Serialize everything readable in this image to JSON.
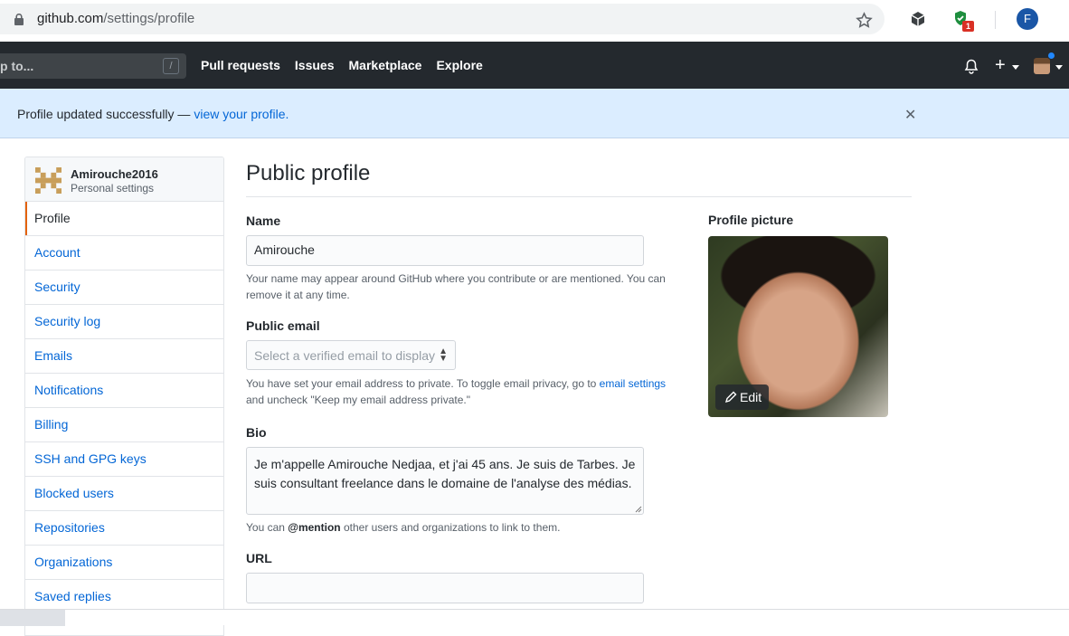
{
  "browser": {
    "url_host": "github.com",
    "url_path": "/settings/profile",
    "ext_badge": "1",
    "profile_initial": "F"
  },
  "header": {
    "search_placeholder": "p to...",
    "search_shortcut": "/",
    "nav": [
      "Pull requests",
      "Issues",
      "Marketplace",
      "Explore"
    ]
  },
  "flash": {
    "message": "Profile updated successfully — ",
    "link": "view your profile.",
    "close_icon": "close-icon"
  },
  "sidebar": {
    "username": "Amirouche2016",
    "subtitle": "Personal settings",
    "items": [
      "Profile",
      "Account",
      "Security",
      "Security log",
      "Emails",
      "Notifications",
      "Billing",
      "SSH and GPG keys",
      "Blocked users",
      "Repositories",
      "Organizations",
      "Saved replies"
    ],
    "active": "Profile"
  },
  "main": {
    "title": "Public profile",
    "name_label": "Name",
    "name_value": "Amirouche",
    "name_note": "Your name may appear around GitHub where you contribute or are mentioned. You can remove it at any time.",
    "email_label": "Public email",
    "email_placeholder": "Select a verified email to display",
    "email_note_1": "You have set your email address to private. To toggle email privacy, go to ",
    "email_note_link": "email settings",
    "email_note_2": "and uncheck \"Keep my email address private.\"",
    "bio_label": "Bio",
    "bio_value": "Je m'appelle Amirouche Nedjaa, et j'ai 45 ans. Je suis de Tarbes. Je suis consultant freelance dans le domaine de l'analyse des médias.",
    "bio_note_1": "You can ",
    "bio_note_mention": "@mention",
    "bio_note_2": " other users and organizations to link to them.",
    "url_label": "URL",
    "url_value": "",
    "picture_label": "Profile picture",
    "edit_label": "Edit"
  },
  "colors": {
    "header_bg": "#24292e",
    "flash_bg": "#dbedff",
    "link": "#0366d6",
    "active_accent": "#e36209"
  }
}
